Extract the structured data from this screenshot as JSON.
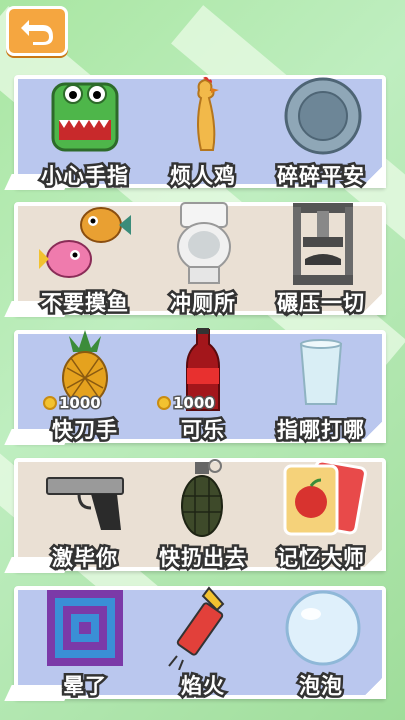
{
  "nav": {
    "back_icon": "back-arrow-icon"
  },
  "colors": {
    "panel_blue": "#bac7ee",
    "panel_beige": "#eae0d4",
    "back_button": "#f5a640"
  },
  "rows": [
    {
      "items": [
        {
          "label": "小心手指",
          "icon": "crocodile-icon"
        },
        {
          "label": "烦人鸡",
          "icon": "rubber-chicken-icon"
        },
        {
          "label": "碎碎平安",
          "icon": "plate-icon"
        }
      ]
    },
    {
      "items": [
        {
          "label": "不要摸鱼",
          "icon": "pufferfish-icon"
        },
        {
          "label": "冲厕所",
          "icon": "toilet-icon"
        },
        {
          "label": "碾压一切",
          "icon": "hydraulic-press-icon"
        }
      ]
    },
    {
      "items": [
        {
          "label": "快刀手",
          "icon": "pineapple-icon",
          "price": "1000"
        },
        {
          "label": "可乐",
          "icon": "cola-bottle-icon",
          "price": "1000"
        },
        {
          "label": "指哪打哪",
          "icon": "glass-cup-icon"
        }
      ]
    },
    {
      "items": [
        {
          "label": "激毕你",
          "icon": "pistol-icon"
        },
        {
          "label": "快扔出去",
          "icon": "grenade-icon"
        },
        {
          "label": "记忆大师",
          "icon": "memory-cards-icon"
        }
      ]
    },
    {
      "items": [
        {
          "label": "晕了",
          "icon": "hypnotic-pattern-icon"
        },
        {
          "label": "焰火",
          "icon": "firework-rocket-icon"
        },
        {
          "label": "泡泡",
          "icon": "bubble-icon"
        }
      ]
    }
  ]
}
